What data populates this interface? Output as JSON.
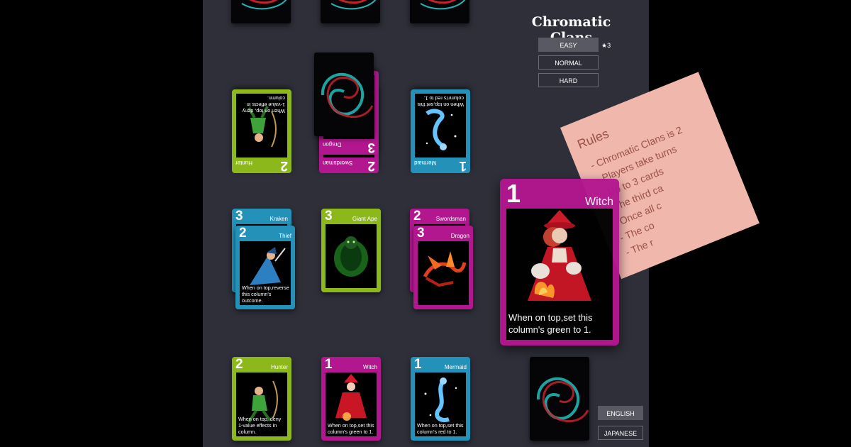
{
  "title": "Chromatic Clans",
  "difficulty": {
    "options": [
      "EASY",
      "NORMAL",
      "HARD"
    ],
    "selected": "EASY",
    "star_label": "★3"
  },
  "language": {
    "options": [
      "ENGLISH",
      "JAPANESE"
    ],
    "selected": "ENGLISH"
  },
  "rules": {
    "title": "Rules",
    "lines": [
      "- Chromatic Clans is 2",
      "- Players take turns",
      "- Up to 3 cards",
      "- The third ca",
      "- Once all c",
      "- The co",
      "- The r"
    ]
  },
  "opponent_row": {
    "cards": [
      {
        "color": "green",
        "value": "2",
        "name": "Hunter",
        "effect": "When on top, deny 1-value effects in column."
      },
      {
        "color": "magenta",
        "value": "2",
        "name": "Swordsman",
        "effect": ""
      },
      {
        "color": "magenta",
        "value": "3",
        "name": "Dragon",
        "effect": ""
      },
      {
        "color": "blue",
        "value": "1",
        "name": "Mermaid",
        "effect": "When on top,set this column's red to 1."
      }
    ]
  },
  "middle_row": {
    "cards": [
      {
        "color": "blue",
        "value": "3",
        "name": "Kraken",
        "effect": ""
      },
      {
        "color": "blue",
        "value": "2",
        "name": "Thief",
        "effect": "When on top,reverse this column's outcome."
      },
      {
        "color": "green",
        "value": "3",
        "name": "Giant Ape",
        "effect": ""
      },
      {
        "color": "magenta",
        "value": "2",
        "name": "Swordsman",
        "effect": ""
      },
      {
        "color": "magenta",
        "value": "3",
        "name": "Dragon",
        "effect": ""
      }
    ]
  },
  "hand": {
    "cards": [
      {
        "color": "green",
        "value": "2",
        "name": "Hunter",
        "effect": "When on top, deny 1-value effects in column."
      },
      {
        "color": "magenta",
        "value": "1",
        "name": "Witch",
        "effect": "When on top,set this column's green to 1."
      },
      {
        "color": "blue",
        "value": "1",
        "name": "Mermaid",
        "effect": "When on top,set this column's red to 1."
      }
    ]
  },
  "preview": {
    "color": "magenta",
    "value": "1",
    "name": "Witch",
    "effect": "When on top,set this column's green to 1."
  },
  "colors": {
    "board": "#2f2f3a",
    "green": "#8cb81c",
    "magenta": "#b3178f",
    "blue": "#2391b8",
    "rules_paper": "#f0b7ad"
  }
}
